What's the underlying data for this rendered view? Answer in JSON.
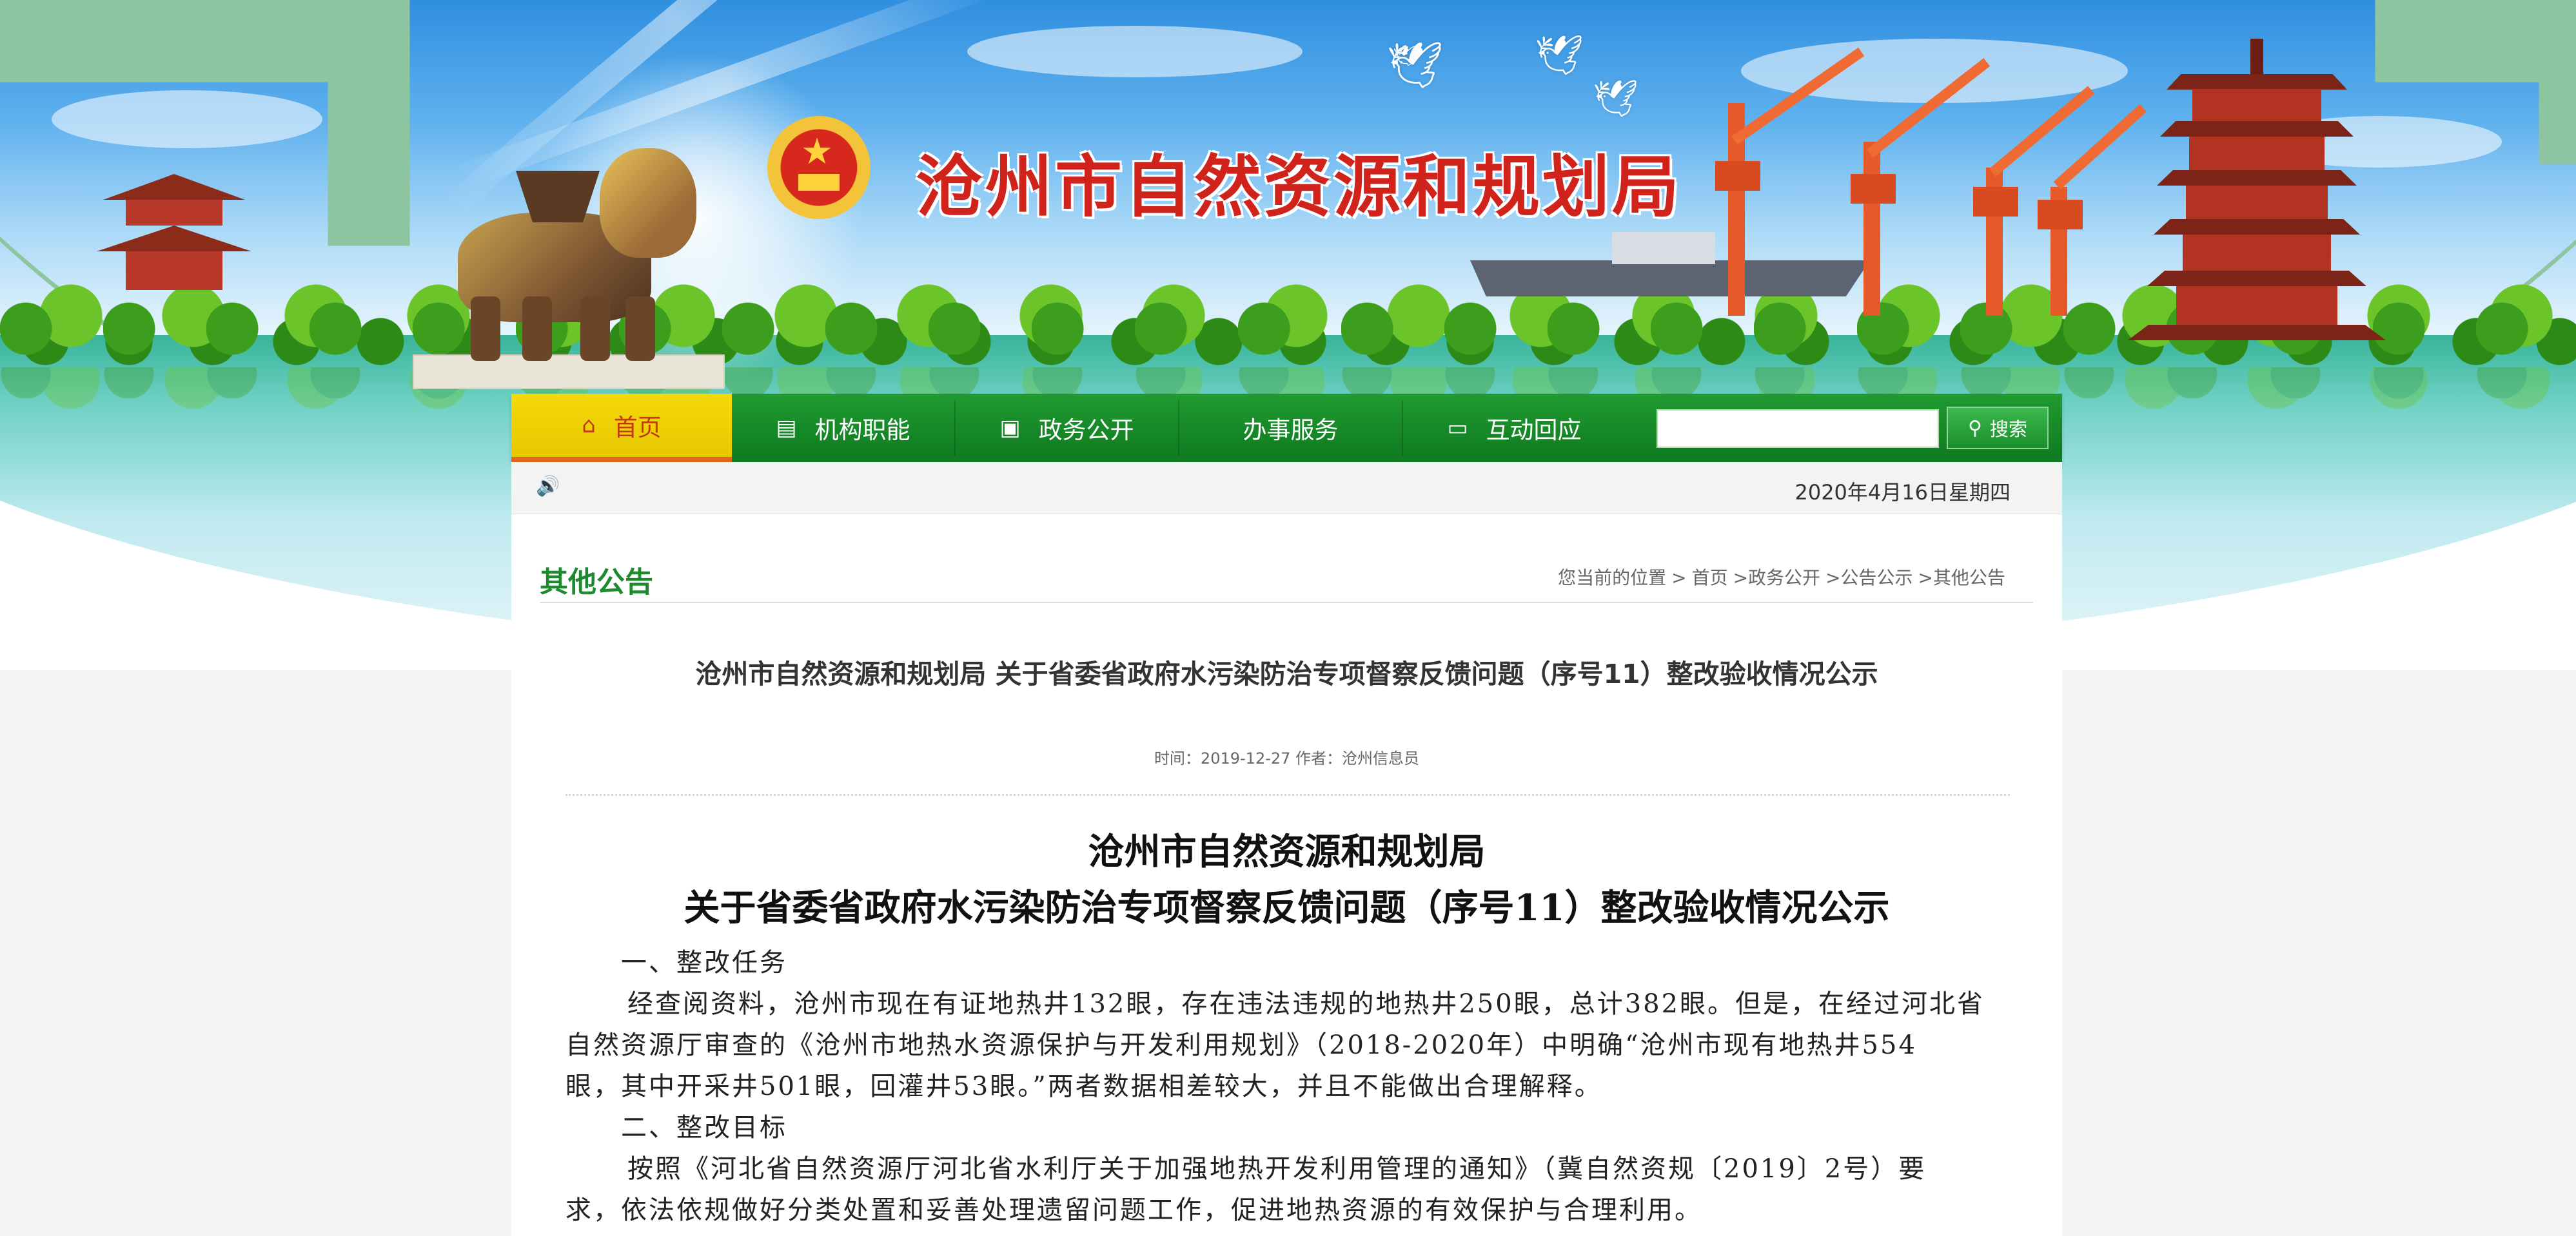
{
  "header": {
    "site_title": "沧州市自然资源和规划局"
  },
  "nav": {
    "items": [
      {
        "label": "首页",
        "icon": "home-icon"
      },
      {
        "label": "机构职能",
        "icon": "document-icon"
      },
      {
        "label": "政务公开",
        "icon": "list-icon"
      },
      {
        "label": "办事服务",
        "icon": ""
      },
      {
        "label": "互动回应",
        "icon": "monitor-icon"
      }
    ],
    "search": {
      "value": "",
      "button_label": "搜索",
      "icon": "search-icon"
    }
  },
  "date_bar": {
    "icon": "speaker-icon",
    "date": "2020年4月16日星期四"
  },
  "section": {
    "title": "其他公告",
    "breadcrumb": {
      "prefix": "您当前的位置",
      "items": [
        "首页",
        ">政务公开",
        ">公告公示",
        ">其他公告"
      ]
    }
  },
  "article": {
    "title": "沧州市自然资源和规划局 关于省委省政府水污染防治专项督察反馈问题（序号11）整改验收情况公示",
    "meta": "时间：2019-12-27 作者：沧州信息员",
    "heading_line1": "沧州市自然资源和规划局",
    "heading_line2": "关于省委省政府水污染防治专项督察反馈问题（序号11）整改验收情况公示",
    "paragraphs": [
      "一、整改任务",
      "经查阅资料，沧州市现在有证地热井132眼，存在违法违规的地热井250眼，总计382眼。但是，在经过河北省",
      "自然资源厅审查的《沧州市地热水资源保护与开发利用规划》（2018-2020年）中明确“沧州市现有地热井554",
      "眼，其中开采井501眼，回灌井53眼。”两者数据相差较大，并且不能做出合理解释。",
      "二、整改目标",
      "按照《河北省自然资源厅河北省水利厅关于加强地热开发利用管理的通知》（冀自然资规〔2019〕2号）要",
      "求，依法依规做好分类处置和妥善处理遗留问题工作，促进地热资源的有效保护与合理利用。"
    ]
  },
  "colors": {
    "nav_green": "#0f7a20",
    "home_yellow": "#e7c800",
    "title_red": "#d0231b",
    "section_green": "#1d8a2d"
  }
}
